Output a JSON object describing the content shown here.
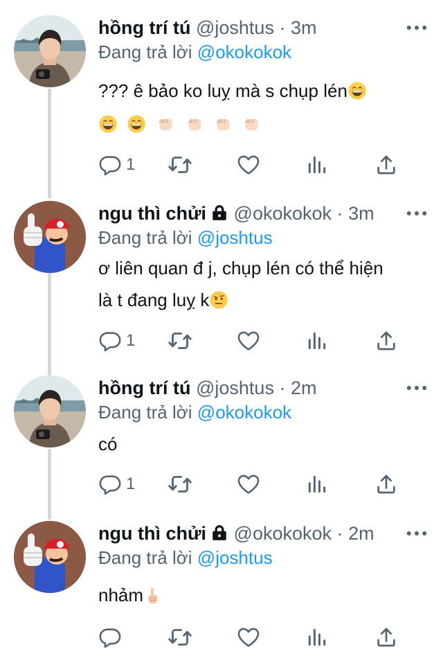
{
  "tweets": [
    {
      "name": "hồng trí tú",
      "handle": "@joshtus",
      "separator": "·",
      "time": "3m",
      "replying_prefix": "Đang trả lời",
      "replying_to": "@okokokok",
      "text_lines": [
        "??? ê bảo ko luỵ mà s chụp lén"
      ],
      "reply_count": "1",
      "locked": false,
      "avatar": "photo-of-person-on-beach"
    },
    {
      "name": "ngu thì chửi",
      "handle": "@okokokok",
      "separator": "·",
      "time": "3m",
      "replying_prefix": "Đang trả lời",
      "replying_to": "@joshtus",
      "text_lines": [
        "ơ liên quan đ j, chụp lén có thể hiện",
        "là t đang luỵ k"
      ],
      "reply_count": "1",
      "locked": true,
      "avatar": "mario-middle-finger"
    },
    {
      "name": "hồng trí tú",
      "handle": "@joshtus",
      "separator": "·",
      "time": "2m",
      "replying_prefix": "Đang trả lời",
      "replying_to": "@okokokok",
      "text_lines": [
        "có"
      ],
      "reply_count": "1",
      "locked": false,
      "avatar": "photo-of-person-on-beach"
    },
    {
      "name": "ngu thì chửi",
      "handle": "@okokokok",
      "separator": "·",
      "time": "2m",
      "replying_prefix": "Đang trả lời",
      "replying_to": "@joshtus",
      "text_lines": [
        "nhảm"
      ],
      "reply_count": "",
      "locked": true,
      "avatar": "mario-middle-finger"
    }
  ],
  "icons": {
    "reply": "reply-icon",
    "retweet": "retweet-icon",
    "like": "heart-icon",
    "views": "views-icon",
    "share": "share-icon",
    "more": "more-icon",
    "lock": "lock-icon"
  },
  "colors": {
    "accent": "#1d9bf0",
    "secondary_text": "#536471",
    "thread_line": "#cfd9de",
    "icon": "#536471"
  }
}
